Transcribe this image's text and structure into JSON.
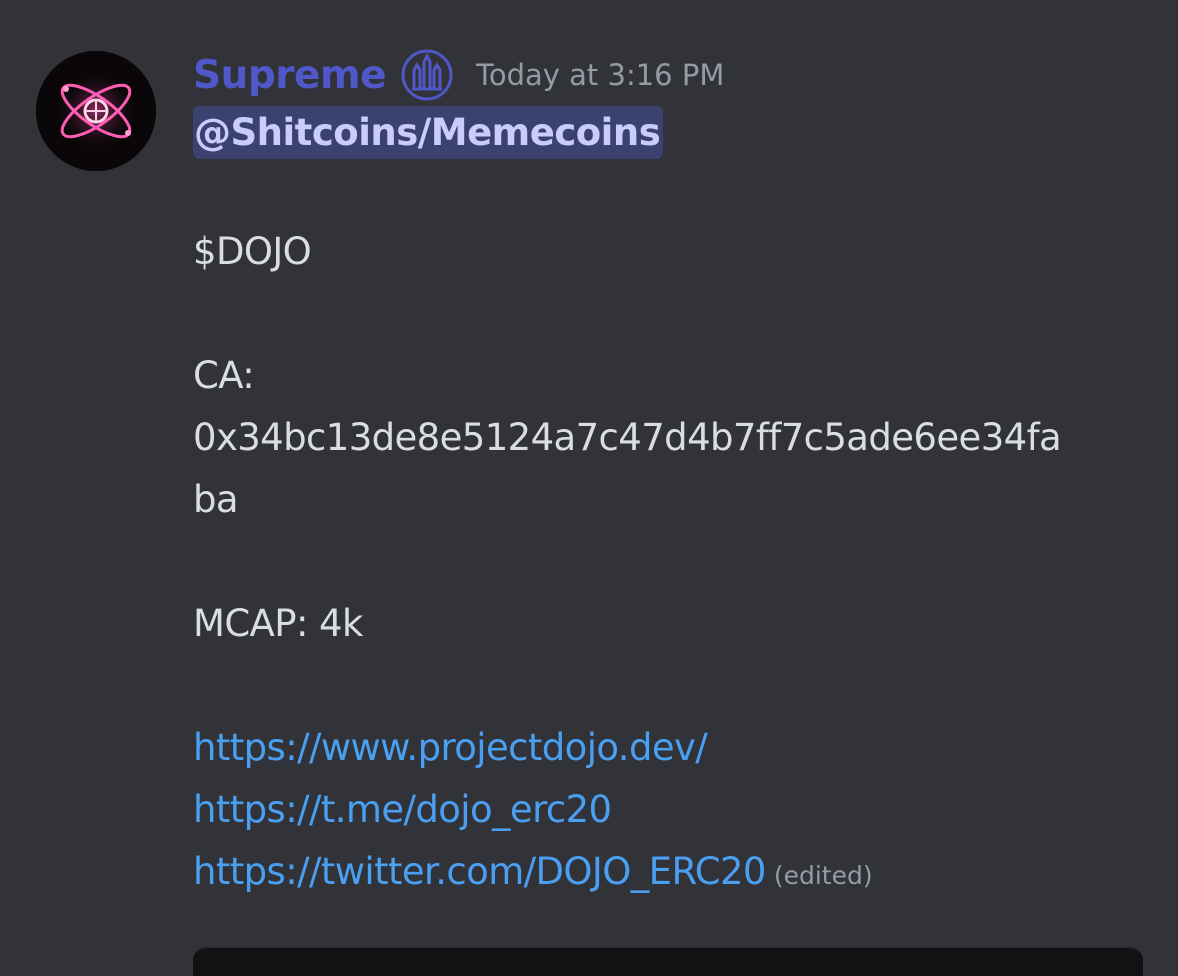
{
  "message": {
    "author": "Supreme",
    "timestamp": "Today at 3:16 PM",
    "mention": "@Shitcoins/Memecoins",
    "ticker": "$DOJO",
    "ca_label": "CA:",
    "ca_line1": "0x34bc13de8e5124a7c47d4b7ff7c5ade6ee34fa",
    "ca_line2": "ba",
    "mcap": "MCAP: 4k",
    "links": [
      "https://www.projectdojo.dev/",
      "https://t.me/dojo_erc20",
      "https://twitter.com/DOJO_ERC20"
    ],
    "edited_label": "(edited)"
  },
  "icons": {
    "avatar": "glowing-atom-basketball-avatar",
    "role": "castle-badge-icon"
  },
  "colors": {
    "background": "#313338",
    "username": "#5057c8",
    "mention_bg": "#3c4270",
    "mention_text": "#c9cdfb",
    "link": "#4a9ff0",
    "muted": "#949ba4"
  }
}
